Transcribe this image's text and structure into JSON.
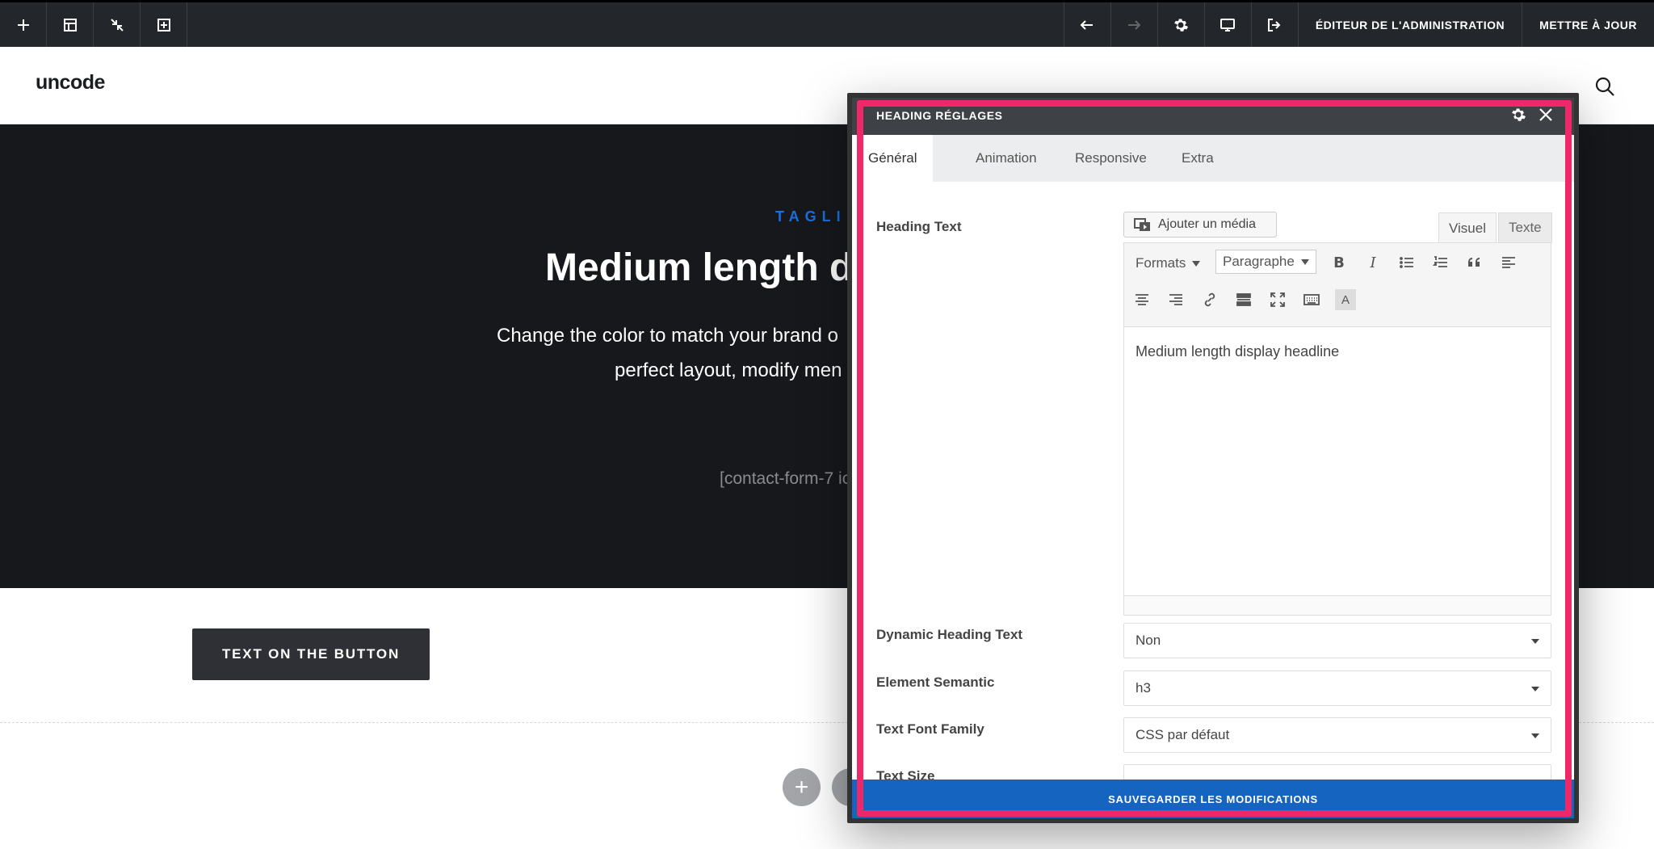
{
  "toolbar": {
    "admin_editor_label": "ÉDITEUR DE L'ADMINISTRATION",
    "update_label": "METTRE À JOUR"
  },
  "site": {
    "logo": "uncode"
  },
  "hero": {
    "tagline": "TAGLI",
    "title": "Medium length di",
    "text_line1": "Change the color to match your brand o",
    "text_line2": "perfect layout, modify men",
    "shortcode": "[contact-form-7 ic"
  },
  "cta": {
    "label": "TEXT ON THE BUTTON"
  },
  "modal": {
    "title": "HEADING RÉGLAGES",
    "tabs": [
      "Général",
      "Animation",
      "Responsive",
      "Extra"
    ],
    "active_tab": "Général",
    "heading_text_label": "Heading Text",
    "add_media_label": "Ajouter un média",
    "visual_tab": "Visuel",
    "text_tab": "Texte",
    "formats_label": "Formats",
    "paragraph_label": "Paragraphe",
    "editor_content": "Medium length display headline",
    "dynamic_heading_label": "Dynamic Heading Text",
    "dynamic_heading_value": "Non",
    "element_semantic_label": "Element Semantic",
    "element_semantic_value": "h3",
    "font_family_label": "Text Font Family",
    "font_family_value": "CSS par défaut",
    "partial_label": "Text Size",
    "save_label": "SAUVEGARDER LES MODIFICATIONS"
  },
  "colors": {
    "highlight": "#ee2869",
    "save_button": "#1565c0",
    "tagline": "#1a6fde"
  }
}
